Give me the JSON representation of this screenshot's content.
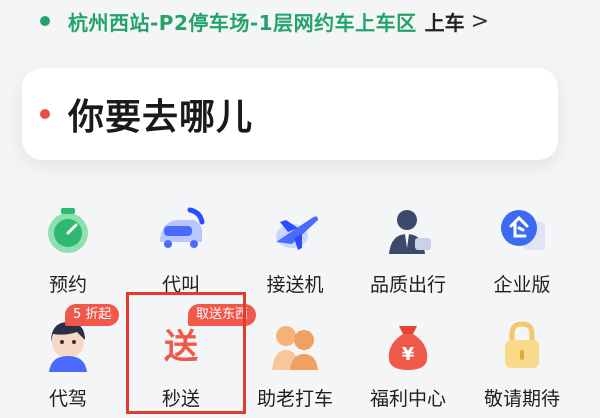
{
  "pickup": {
    "location": "杭州西站-P2停车场-1层网约车上车区",
    "action": "上车",
    "chevron": ">"
  },
  "destination": {
    "placeholder": "你要去哪儿"
  },
  "services": [
    {
      "label": "预约",
      "icon": "clock-icon"
    },
    {
      "label": "代叫",
      "icon": "car-phone-icon"
    },
    {
      "label": "接送机",
      "icon": "airplane-icon"
    },
    {
      "label": "品质出行",
      "icon": "chauffeur-icon"
    },
    {
      "label": "企业版",
      "icon": "enterprise-icon"
    },
    {
      "label": "代驾",
      "icon": "driver-avatar-icon",
      "badge": "5 折起"
    },
    {
      "label": "秒送",
      "icon": "delivery-icon",
      "badge": "取送东西",
      "highlighted": true
    },
    {
      "label": "助老打车",
      "icon": "elderly-icon"
    },
    {
      "label": "福利中心",
      "icon": "money-bag-icon"
    },
    {
      "label": "敬请期待",
      "icon": "lock-icon"
    }
  ],
  "colors": {
    "accent": "#23a36b",
    "badge": "#f0584a",
    "highlight_border": "#e23a2c"
  }
}
